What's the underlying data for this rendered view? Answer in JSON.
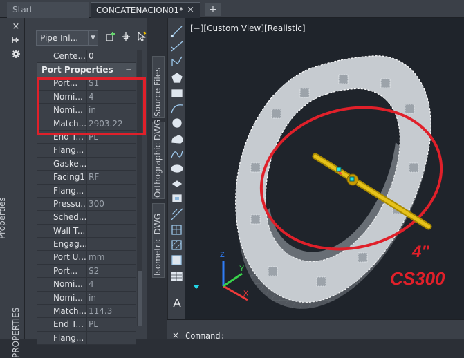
{
  "tabs": {
    "start_label": "Start",
    "doc_label": "CONCATENACION01*",
    "close_glyph": "×",
    "add_glyph": "+"
  },
  "palette_strip": {
    "close_glyph": "×",
    "title_top": "Properties",
    "title_bottom": "PROPERTIES"
  },
  "properties": {
    "selector_value": "Pipe Inl...",
    "rows_top": [
      {
        "label": "Cente...",
        "value": "0"
      }
    ],
    "section_title": "Port Properties",
    "section_toggle": "−",
    "rows": [
      {
        "label": "Port...",
        "value": "S1"
      },
      {
        "label": "Nomi...",
        "value": "4"
      },
      {
        "label": "Nomi...",
        "value": "in"
      },
      {
        "label": "Match...",
        "value": "2903.22"
      },
      {
        "label": "End T...",
        "value": "PL"
      },
      {
        "label": "Flang...",
        "value": ""
      },
      {
        "label": "Gaske...",
        "value": ""
      },
      {
        "label": "Facing1",
        "value": "RF"
      },
      {
        "label": "Flang...",
        "value": ""
      },
      {
        "label": "Pressu...",
        "value": "300"
      },
      {
        "label": "Sched...",
        "value": ""
      },
      {
        "label": "Wall T...",
        "value": ""
      },
      {
        "label": "Engag...",
        "value": ""
      },
      {
        "label": "Port U...",
        "value": "mm"
      },
      {
        "label": "Port...",
        "value": "S2"
      },
      {
        "label": "Nomi...",
        "value": "4"
      },
      {
        "label": "Nomi...",
        "value": "in"
      },
      {
        "label": "Match...",
        "value": "114.3"
      },
      {
        "label": "End T...",
        "value": "PL"
      },
      {
        "label": "Flang...",
        "value": ""
      }
    ]
  },
  "vertical_tabs": {
    "tab1": "Source Files",
    "tab2": "Orthographic DWG",
    "tab3": "Isometric DWG"
  },
  "viewport": {
    "label": "[−][Custom View][Realistic]",
    "annotation_size": "4\"",
    "annotation_class": "CS300",
    "ucs_x": "X",
    "ucs_y": "Y",
    "ucs_z": "Z"
  },
  "command": {
    "close_glyph": "×",
    "prompt": "Command:"
  },
  "colors": {
    "markup_red": "#e0202a",
    "pipe_yellow": "#d9b300",
    "grip_cyan": "#22e6e6"
  },
  "icons": {
    "tool_line": "line-icon",
    "tool_xline": "construction-line-icon",
    "tool_polyline": "polyline-icon",
    "tool_polygon": "polygon-icon",
    "tool_rectangle": "rectangle-icon",
    "tool_arc": "arc-icon",
    "tool_circle": "circle-icon",
    "tool_revcloud": "revision-cloud-icon",
    "tool_spline": "spline-icon",
    "tool_ellipse": "ellipse-icon",
    "tool_insert": "insert-block-icon",
    "tool_point": "point-icon",
    "tool_hatch": "hatch-icon",
    "tool_region": "region-icon",
    "tool_table": "table-icon",
    "tool_text": "multiline-text-icon"
  }
}
